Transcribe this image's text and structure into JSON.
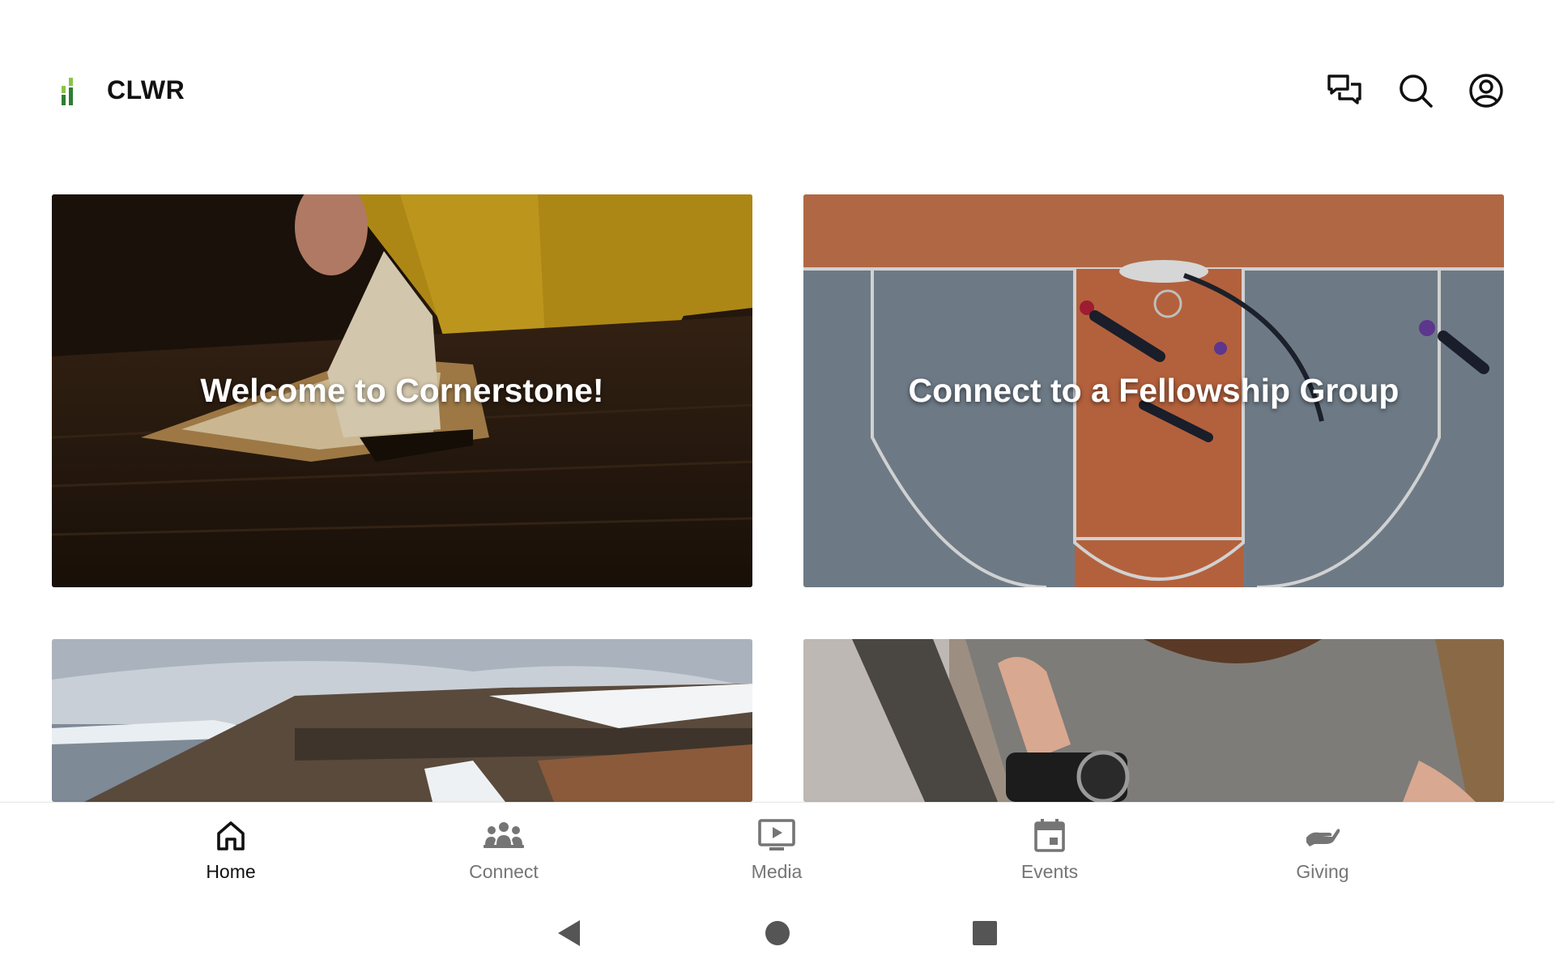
{
  "header": {
    "app_name": "CLWR",
    "icons": [
      "chat-icon",
      "search-icon",
      "account-icon"
    ]
  },
  "cards": [
    {
      "title": "Welcome to Cornerstone!",
      "image": "bible-reading-photo"
    },
    {
      "title": "Connect to a Fellowship Group",
      "image": "basketball-court-aerial-photo"
    },
    {
      "title": "",
      "image": "snowy-cliff-landscape-photo"
    },
    {
      "title": "",
      "image": "person-holding-camera-photo"
    }
  ],
  "bottom_nav": {
    "items": [
      {
        "label": "Home",
        "icon": "home-icon",
        "active": true
      },
      {
        "label": "Connect",
        "icon": "group-icon",
        "active": false
      },
      {
        "label": "Media",
        "icon": "media-play-icon",
        "active": false
      },
      {
        "label": "Events",
        "icon": "calendar-icon",
        "active": false
      },
      {
        "label": "Giving",
        "icon": "giving-hand-icon",
        "active": false
      }
    ]
  },
  "system_nav": [
    "back-icon",
    "home-circle-icon",
    "recents-square-icon"
  ],
  "colors": {
    "logo_green_dark": "#2e7d32",
    "logo_green_light": "#8bc34a",
    "active_nav": "#111111",
    "inactive_nav": "#757575"
  }
}
